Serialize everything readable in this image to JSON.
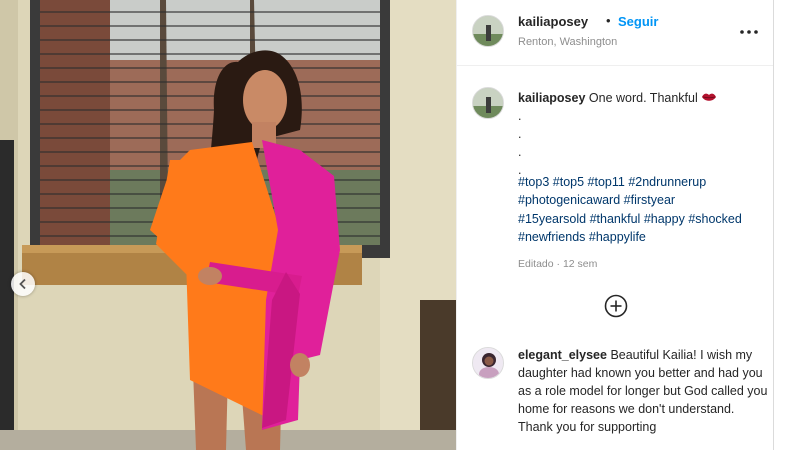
{
  "post": {
    "username": "kailiaposey",
    "separator": "•",
    "follow_label": "Seguir",
    "location": "Renton, Washington",
    "more_icon": "more-options-icon"
  },
  "caption": {
    "username": "kailiaposey",
    "text": "One word. Thankful",
    "emoji_icon": "lips-emoji-icon",
    "dot_lines": [
      ".",
      ".",
      ".",
      "."
    ],
    "hashtags": [
      "#top3",
      "#top5",
      "#top11",
      "#2ndrunnerup",
      "#photogenicaward",
      "#firstyear",
      "#15yearsold",
      "#thankful",
      "#happy",
      "#shocked",
      "#newfriends",
      "#happylife"
    ],
    "edited_label": "Editado · 12 sem"
  },
  "actions": {
    "load_more_icon": "add-circle-icon"
  },
  "comment": {
    "username": "elegant_elysee",
    "text": "Beautiful Kailia! I wish my daughter had known you better and had you as a role model for longer but God called you home for reasons we don't understand. Thank you for supporting"
  },
  "photo": {
    "prev_icon": "chevron-left-icon"
  },
  "colors": {
    "link": "#0095f6",
    "hashtag": "#00376b",
    "muted": "#8e8e8e",
    "dress_orange": "#ff7a1a",
    "dress_pink": "#e0209a"
  }
}
